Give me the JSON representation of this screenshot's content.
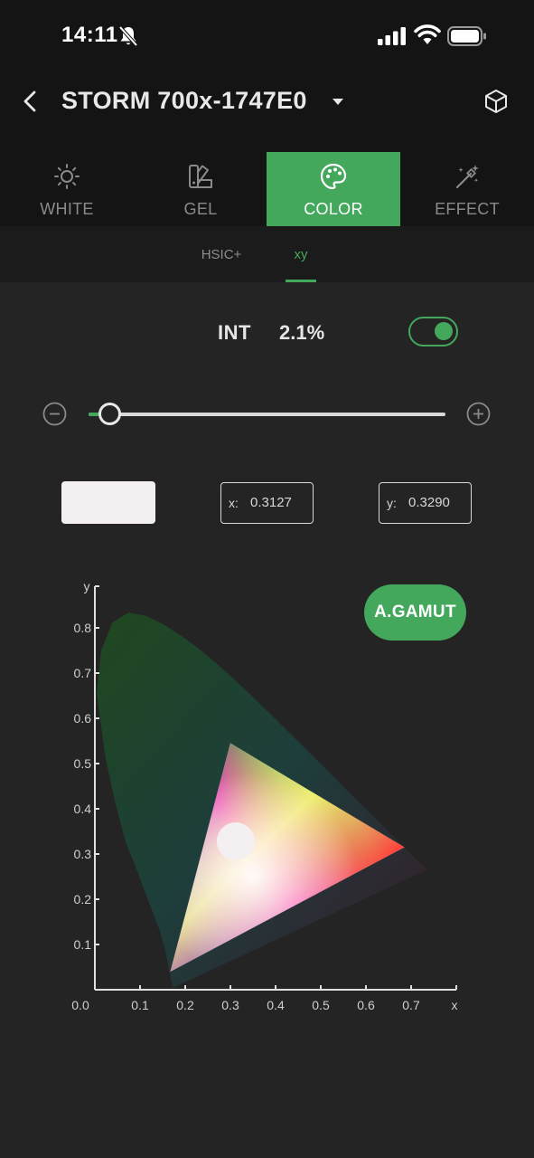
{
  "status": {
    "time": "14:11",
    "icons": [
      "bell-muted-icon",
      "signal-icon",
      "wifi-icon",
      "battery-icon"
    ]
  },
  "header": {
    "title": "STORM 700x-1747E0",
    "back_icon": "chevron-left-icon",
    "dropdown_icon": "caret-down-icon",
    "right_icon": "cube-icon"
  },
  "tabs": [
    {
      "label": "WHITE",
      "icon": "sun-icon",
      "active": false
    },
    {
      "label": "GEL",
      "icon": "swatch-book-icon",
      "active": false
    },
    {
      "label": "COLOR",
      "icon": "palette-icon",
      "active": true
    },
    {
      "label": "EFFECT",
      "icon": "magic-wand-icon",
      "active": false
    }
  ],
  "subtabs": [
    {
      "label": "HSIC+",
      "active": false
    },
    {
      "label": "xy",
      "active": true
    }
  ],
  "intensity": {
    "label": "INT",
    "value": "2.1%",
    "fraction": 0.021,
    "enabled": true
  },
  "color": {
    "swatch": "#f4eff0",
    "x_label": "x:",
    "x_value": "0.3127",
    "y_label": "y:",
    "y_value": "0.3290"
  },
  "gamut_button": "A.GAMUT",
  "colors": {
    "accent": "#43a85c",
    "background": "#242424",
    "bar": "#141414"
  },
  "chart_data": {
    "type": "scatter",
    "xlabel": "x",
    "ylabel": "y",
    "xlim": [
      0,
      0.8
    ],
    "ylim": [
      0,
      0.9
    ],
    "x_ticks": [
      "0.0",
      "0.1",
      "0.2",
      "0.3",
      "0.4",
      "0.5",
      "0.6",
      "0.7"
    ],
    "y_ticks": [
      "0.1",
      "0.2",
      "0.3",
      "0.4",
      "0.5",
      "0.6",
      "0.7",
      "0.8"
    ],
    "origin_label": "0.0",
    "spectral_locus": [
      [
        0.1741,
        0.005
      ],
      [
        0.1738,
        0.0049
      ],
      [
        0.172,
        0.0096
      ],
      [
        0.1689,
        0.0223
      ],
      [
        0.1644,
        0.0448
      ],
      [
        0.1566,
        0.0832
      ],
      [
        0.144,
        0.1298
      ],
      [
        0.1241,
        0.1814
      ],
      [
        0.0913,
        0.2684
      ],
      [
        0.0687,
        0.3247
      ],
      [
        0.0454,
        0.4127
      ],
      [
        0.0235,
        0.5125
      ],
      [
        0.0082,
        0.6239
      ],
      [
        0.0039,
        0.6548
      ],
      [
        0.0139,
        0.7502
      ],
      [
        0.0389,
        0.812
      ],
      [
        0.0743,
        0.8338
      ],
      [
        0.1142,
        0.8262
      ],
      [
        0.1547,
        0.8059
      ],
      [
        0.1929,
        0.7816
      ],
      [
        0.2296,
        0.7543
      ],
      [
        0.2658,
        0.7243
      ],
      [
        0.3016,
        0.6923
      ],
      [
        0.3373,
        0.6589
      ],
      [
        0.3731,
        0.6245
      ],
      [
        0.4087,
        0.5896
      ],
      [
        0.4441,
        0.5547
      ],
      [
        0.4788,
        0.5202
      ],
      [
        0.5125,
        0.4866
      ],
      [
        0.5448,
        0.4544
      ],
      [
        0.5752,
        0.4242
      ],
      [
        0.6029,
        0.3965
      ],
      [
        0.627,
        0.3725
      ],
      [
        0.6482,
        0.3514
      ],
      [
        0.6658,
        0.334
      ],
      [
        0.6801,
        0.3197
      ],
      [
        0.6915,
        0.3083
      ],
      [
        0.7006,
        0.2993
      ],
      [
        0.7079,
        0.292
      ],
      [
        0.714,
        0.2859
      ],
      [
        0.719,
        0.2809
      ],
      [
        0.723,
        0.277
      ],
      [
        0.726,
        0.274
      ],
      [
        0.7347,
        0.2653
      ]
    ],
    "gamut_triangle": [
      [
        0.3,
        0.545
      ],
      [
        0.685,
        0.315
      ],
      [
        0.167,
        0.04
      ]
    ],
    "selected_point": {
      "x": 0.3127,
      "y": 0.329
    }
  }
}
